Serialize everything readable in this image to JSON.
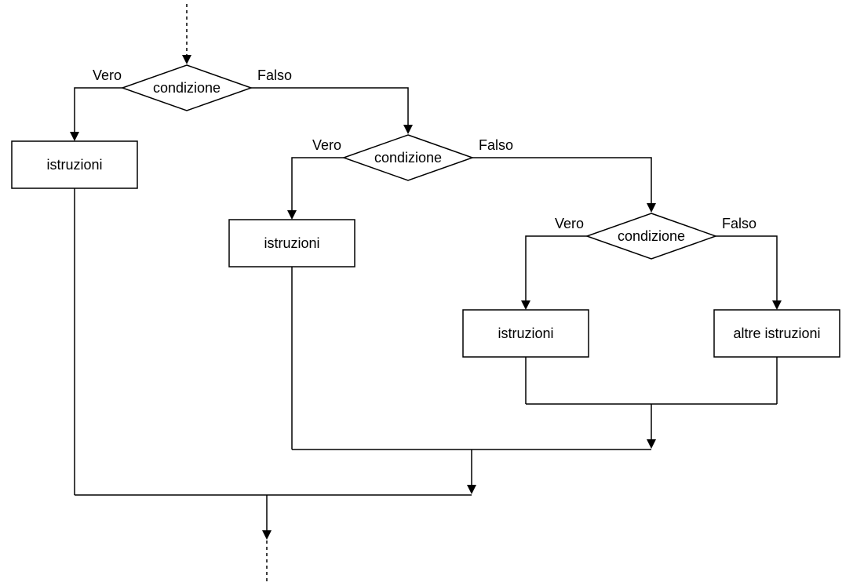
{
  "labels": {
    "true": "Vero",
    "false": "Falso",
    "condition": "condizione",
    "instructions": "istruzioni",
    "other_instructions": "altre istruzioni"
  },
  "nodes": {
    "cond1": {
      "type": "decision",
      "textKey": "condition"
    },
    "cond2": {
      "type": "decision",
      "textKey": "condition"
    },
    "cond3": {
      "type": "decision",
      "textKey": "condition"
    },
    "instr1": {
      "type": "process",
      "textKey": "instructions"
    },
    "instr2": {
      "type": "process",
      "textKey": "instructions"
    },
    "instr3": {
      "type": "process",
      "textKey": "instructions"
    },
    "other": {
      "type": "process",
      "textKey": "other_instructions"
    }
  },
  "edges": [
    {
      "from": "start",
      "to": "cond1"
    },
    {
      "from": "cond1",
      "to": "instr1",
      "labelKey": "true"
    },
    {
      "from": "cond1",
      "to": "cond2",
      "labelKey": "false"
    },
    {
      "from": "cond2",
      "to": "instr2",
      "labelKey": "true"
    },
    {
      "from": "cond2",
      "to": "cond3",
      "labelKey": "false"
    },
    {
      "from": "cond3",
      "to": "instr3",
      "labelKey": "true"
    },
    {
      "from": "cond3",
      "to": "other",
      "labelKey": "false"
    },
    {
      "from": "instr3",
      "to": "merge3"
    },
    {
      "from": "other",
      "to": "merge3"
    },
    {
      "from": "merge3",
      "to": "merge2"
    },
    {
      "from": "instr2",
      "to": "merge2"
    },
    {
      "from": "merge2",
      "to": "merge1"
    },
    {
      "from": "instr1",
      "to": "merge1"
    },
    {
      "from": "merge1",
      "to": "end"
    }
  ]
}
